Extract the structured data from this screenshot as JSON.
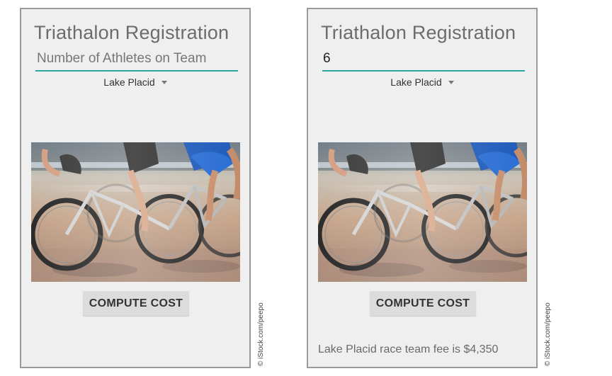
{
  "screens": [
    {
      "title": "Triathalon Registration",
      "athletes_placeholder": "Number of Athletes on Team",
      "athletes_value": "",
      "location_selected": "Lake Placid",
      "button_label": "COMPUTE COST",
      "result_text": ""
    },
    {
      "title": "Triathalon Registration",
      "athletes_placeholder": "Number of Athletes on Team",
      "athletes_value": "6",
      "location_selected": "Lake Placid",
      "button_label": "COMPUTE COST",
      "result_text": "Lake Placid race team fee is $4,350"
    }
  ],
  "photo_credit": "© iStock.com/peepo",
  "colors": {
    "accent_underline": "#27a89a",
    "screen_background": "#efeff0",
    "button_background": "#dcdcdc"
  },
  "icons": {
    "dropdown": "triangle-down-icon"
  }
}
